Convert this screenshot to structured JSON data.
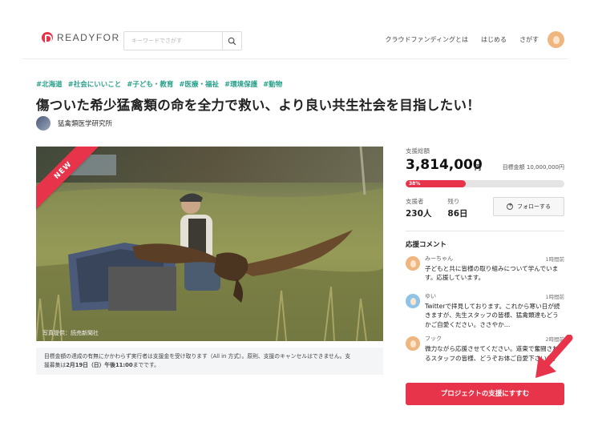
{
  "header": {
    "logo": "READYFOR",
    "search_placeholder": "キーワードでさがす",
    "nav": [
      "クラウドファンディングとは",
      "はじめる",
      "さがす"
    ]
  },
  "project": {
    "tags": [
      "#北海道",
      "#社会にいいこと",
      "#子ども・教育",
      "#医療・福祉",
      "#環境保護",
      "#動物"
    ],
    "title": "傷ついた希少猛禽類の命を全力で救い、より良い共生社会を目指したい！",
    "owner": "猛禽類医学研究所",
    "badge": "NEW",
    "photo_credit": "写真提供：読売新聞社",
    "notice_line1": "目標金額の達成の有無にかかわらず実行者は支援金を受け取ります（All in 方式）。原則、支援のキャンセルはできません。支",
    "notice_line2_prefix": "援募集は",
    "notice_line2_bold": "2月19日（日）午後11:00",
    "notice_line2_suffix": "までです。"
  },
  "funding": {
    "total_label": "支援総額",
    "amount": "3,814,000",
    "unit": "円",
    "target": "目標金額 10,000,000円",
    "progress_percent": 38,
    "progress_label": "38%",
    "backers_label": "支援者",
    "backers": "230人",
    "remaining_label": "残り",
    "remaining": "86日",
    "follow_label": "フォローする"
  },
  "comments": {
    "title": "応援コメント",
    "items": [
      {
        "name": "みーちゃん",
        "time": "1時間前",
        "text": "子どもと共に皆様の取り組みについて学んでいます。応援しています。",
        "color": "#f0b67f"
      },
      {
        "name": "ゆい",
        "time": "1時間前",
        "text": "Twitterで拝見しております。これから寒い日が続きますが、先生スタッフの皆様、猛禽類達もどうかご自愛ください。ささやか…",
        "color": "#8fc3e8"
      },
      {
        "name": "フック",
        "time": "2時間前",
        "text": "微力ながら応援させてください。道東で奮闘されるスタッフの皆様、どうぞお体ご自愛下さいね。",
        "color": "#f0b67f"
      }
    ]
  },
  "cta": {
    "label": "プロジェクトの支援にすすむ"
  },
  "colors": {
    "accent": "#e8344a",
    "tag": "#27a08a"
  }
}
